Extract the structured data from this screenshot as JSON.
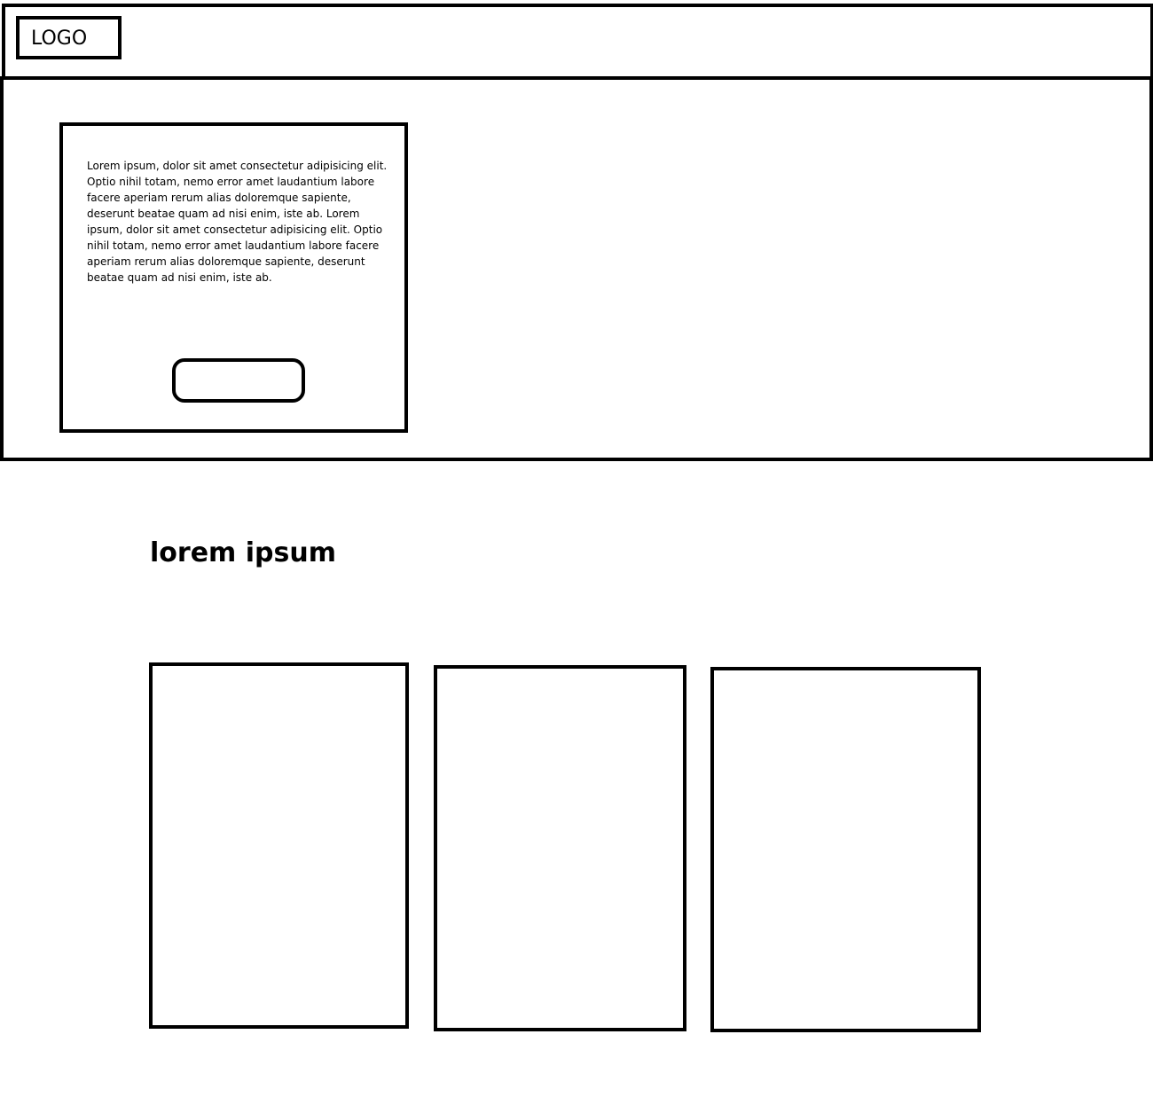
{
  "header": {
    "logo_label": "LOGO"
  },
  "hero": {
    "body_text": "Lorem ipsum, dolor sit amet consectetur adipisicing elit. Optio nihil totam, nemo error amet laudantium labore facere aperiam rerum alias doloremque sapiente, deserunt beatae quam ad nisi enim, iste ab. Lorem ipsum, dolor sit amet consectetur adipisicing elit. Optio nihil totam, nemo error amet laudantium labore facere aperiam rerum alias doloremque sapiente, deserunt beatae quam ad nisi enim, iste ab.",
    "button_label": ""
  },
  "section": {
    "title": "lorem ipsum"
  },
  "colors": {
    "stroke": "#000000",
    "background": "#ffffff"
  }
}
